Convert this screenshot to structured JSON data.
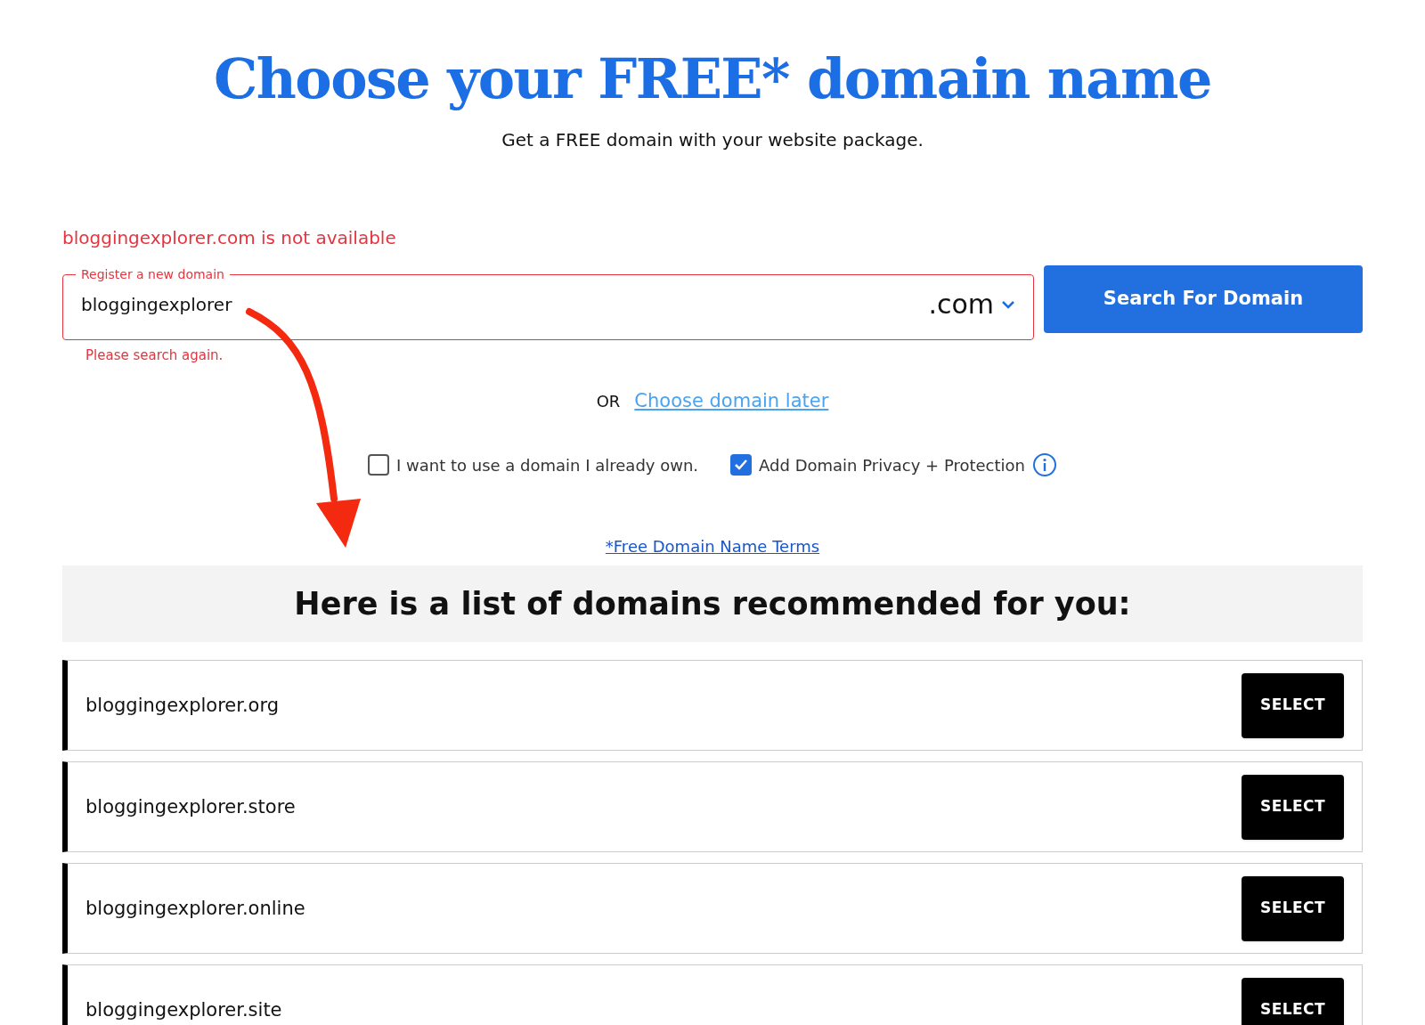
{
  "heading": "Choose your FREE* domain name",
  "subtitle": "Get a FREE domain with your website package.",
  "error": "bloggingexplorer.com is not available",
  "domain_field": {
    "label": "Register a new domain",
    "value": "bloggingexplorer",
    "tld": ".com",
    "hint": "Please search again."
  },
  "search_button": "Search For Domain",
  "or_text": "OR",
  "later_link": "Choose domain later",
  "options": [
    {
      "label": "I want to use a domain I already own.",
      "checked": false
    },
    {
      "label": "Add Domain Privacy + Protection",
      "checked": true
    }
  ],
  "terms_link": "*Free Domain Name Terms",
  "list_title": "Here is a list of domains recommended for you:",
  "domains": [
    {
      "name": "bloggingexplorer.org",
      "button": "SELECT"
    },
    {
      "name": "bloggingexplorer.store",
      "button": "SELECT"
    },
    {
      "name": "bloggingexplorer.online",
      "button": "SELECT"
    },
    {
      "name": "bloggingexplorer.site",
      "button": "SELECT"
    }
  ]
}
